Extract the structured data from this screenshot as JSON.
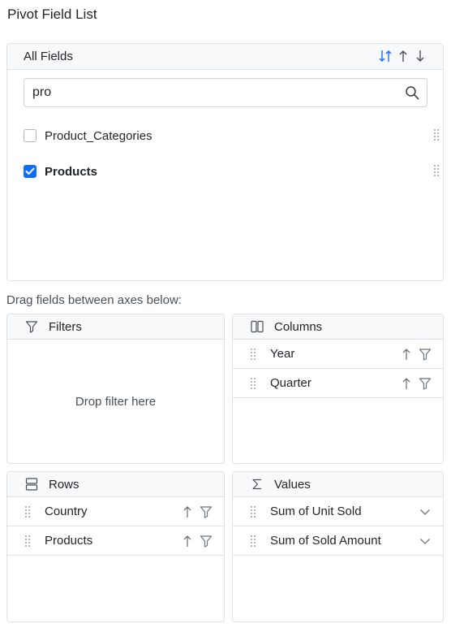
{
  "window": {
    "title": "Pivot Field List"
  },
  "all_fields": {
    "header": "All Fields",
    "sort_icons": [
      "sort-default-icon",
      "sort-ascending-icon",
      "sort-descending-icon"
    ],
    "search": {
      "value": "pro",
      "placeholder": ""
    },
    "fields": [
      {
        "label": "Product_Categories",
        "checked": false
      },
      {
        "label": "Products",
        "checked": true
      }
    ]
  },
  "drag_hint": "Drag fields between axes below:",
  "axes": {
    "filters": {
      "header": "Filters",
      "icon": "filter-icon",
      "empty_text": "Drop filter here",
      "items": []
    },
    "columns": {
      "header": "Columns",
      "icon": "columns-icon",
      "items": [
        {
          "label": "Year"
        },
        {
          "label": "Quarter"
        }
      ]
    },
    "rows": {
      "header": "Rows",
      "icon": "rows-icon",
      "items": [
        {
          "label": "Country"
        },
        {
          "label": "Products"
        }
      ]
    },
    "values": {
      "header": "Values",
      "icon": "sigma-icon",
      "items": [
        {
          "label": "Sum of Unit Sold"
        },
        {
          "label": "Sum of Sold Amount"
        }
      ]
    }
  },
  "colors": {
    "accent": "#0d6efd",
    "border": "#dee2e6",
    "header_bg": "#f8f9fa",
    "icon": "#6c757d"
  }
}
